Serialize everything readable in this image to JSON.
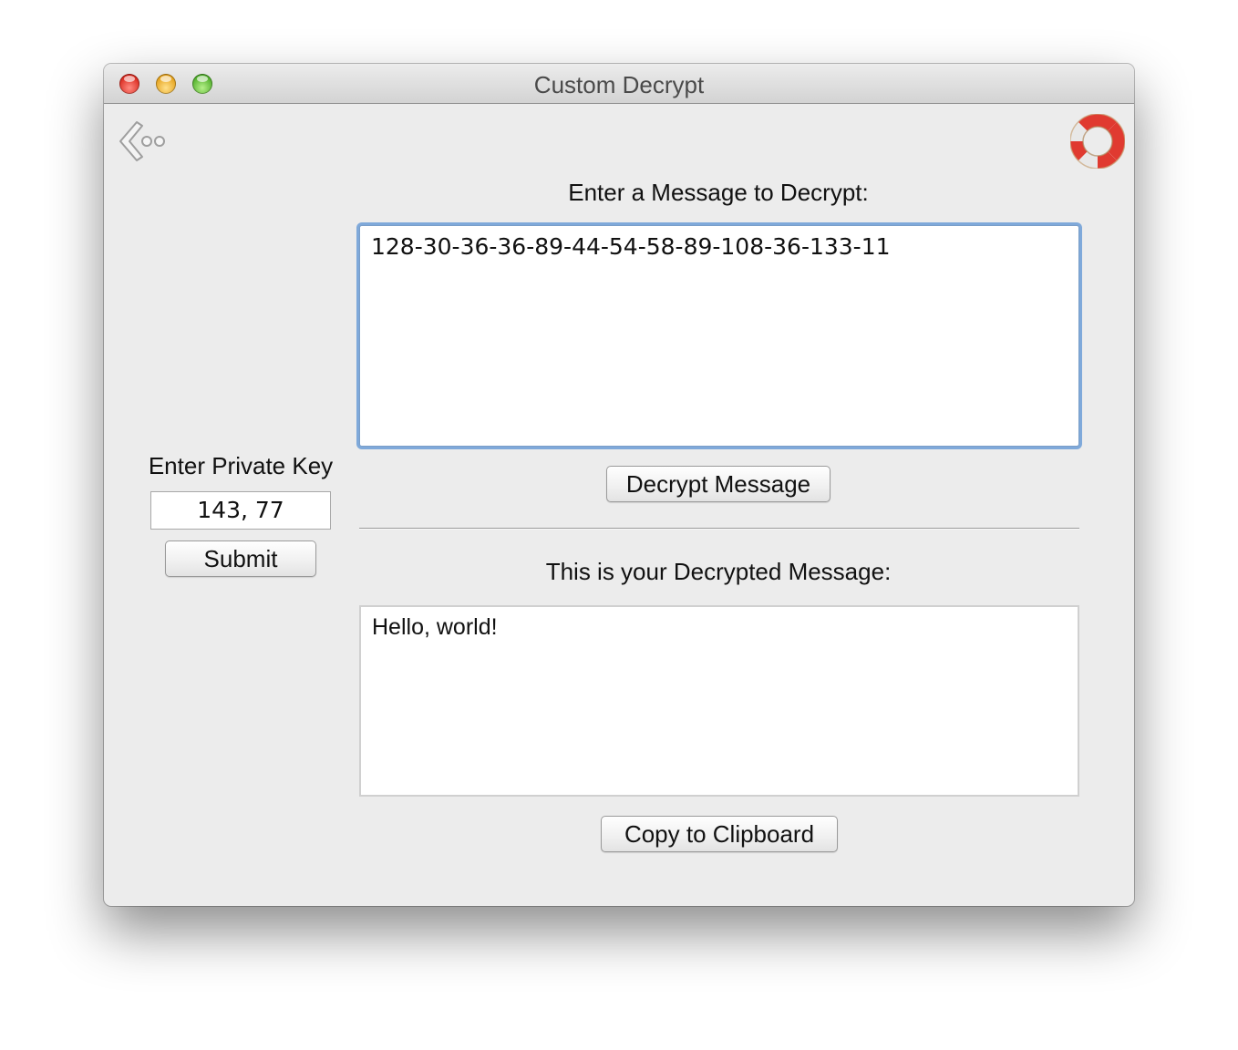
{
  "window": {
    "title": "Custom Decrypt"
  },
  "toolbar": {
    "back_icon": "back-arrow-icon",
    "help_icon": "lifebuoy-help-icon"
  },
  "message_section": {
    "label": "Enter a Message to Decrypt:",
    "input_value": "128-30-36-36-89-44-54-58-89-108-36-133-11",
    "decrypt_button": "Decrypt Message"
  },
  "key_section": {
    "label": "Enter Private Key",
    "key_value": "143, 77",
    "submit_button": "Submit"
  },
  "result_section": {
    "label": "This is your Decrypted Message:",
    "output_value": "Hello, world!",
    "copy_button": "Copy to Clipboard"
  },
  "colors": {
    "window_bg": "#ececec",
    "focus_ring": "#7fa9da",
    "close": "#d9281d",
    "minimize": "#e5a11a",
    "zoom": "#4fae2a"
  }
}
